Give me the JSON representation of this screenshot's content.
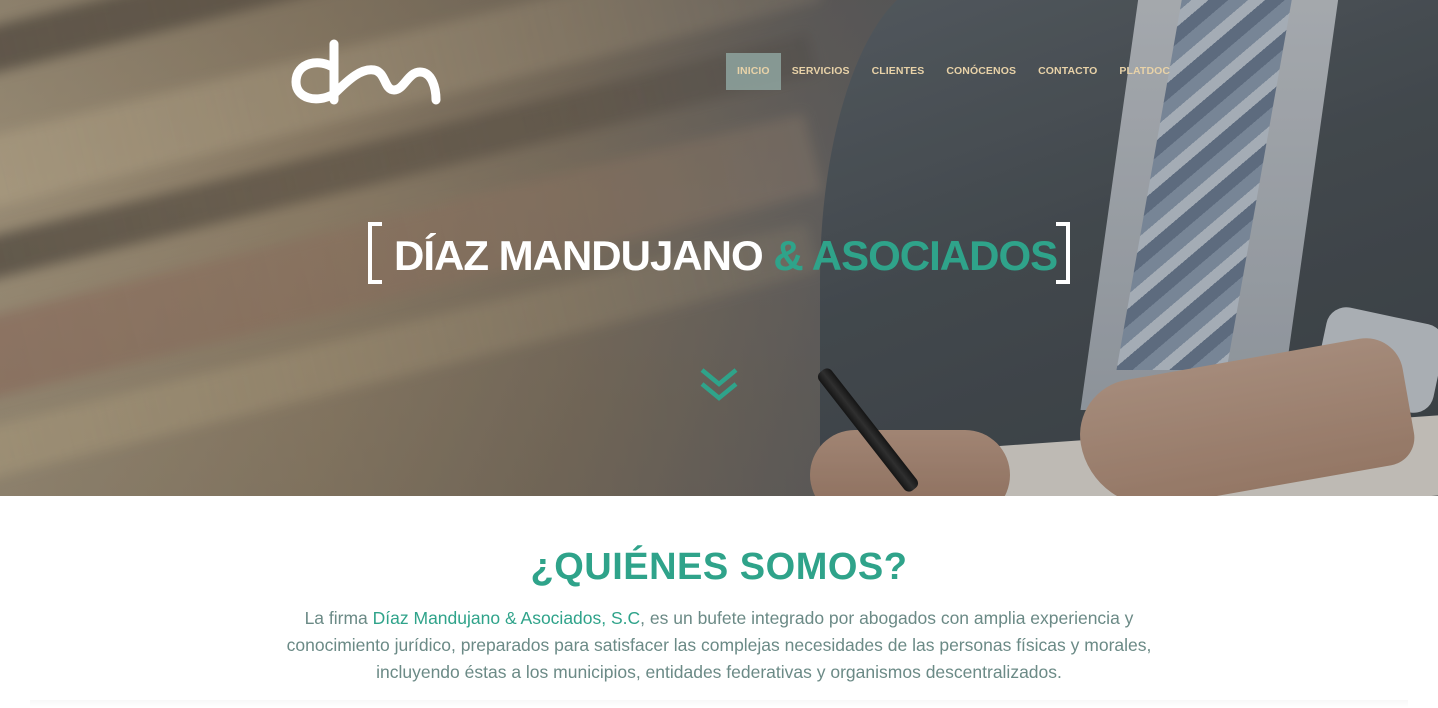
{
  "brand": {
    "logo_text": "dm"
  },
  "nav": {
    "items": [
      {
        "label": "INICIO",
        "active": true
      },
      {
        "label": "SERVICIOS",
        "active": false
      },
      {
        "label": "CLIENTES",
        "active": false
      },
      {
        "label": "CONÓCENOS",
        "active": false
      },
      {
        "label": "CONTACTO",
        "active": false
      },
      {
        "label": "PLATDOC",
        "active": false
      }
    ]
  },
  "hero": {
    "title_main": "DÍAZ MANDUJANO",
    "title_accent": "& ASOCIADOS",
    "scroll_icon": "double-chevron-down-icon"
  },
  "about": {
    "heading": "¿QUIÉNES SOMOS?",
    "intro": "La firma ",
    "firm_name": "Díaz Mandujano & Asociados, S.C",
    "body": ", es un bufete integrado por abogados con amplia experiencia y conocimiento jurídico, preparados para satisfacer las complejas necesidades de las personas físicas y morales, incluyendo éstas a los municipios, entidades federativas y organismos descentralizados."
  },
  "colors": {
    "accent": "#2fa38a",
    "nav_text": "#e8d2a8",
    "body_text": "#6b8a86"
  }
}
